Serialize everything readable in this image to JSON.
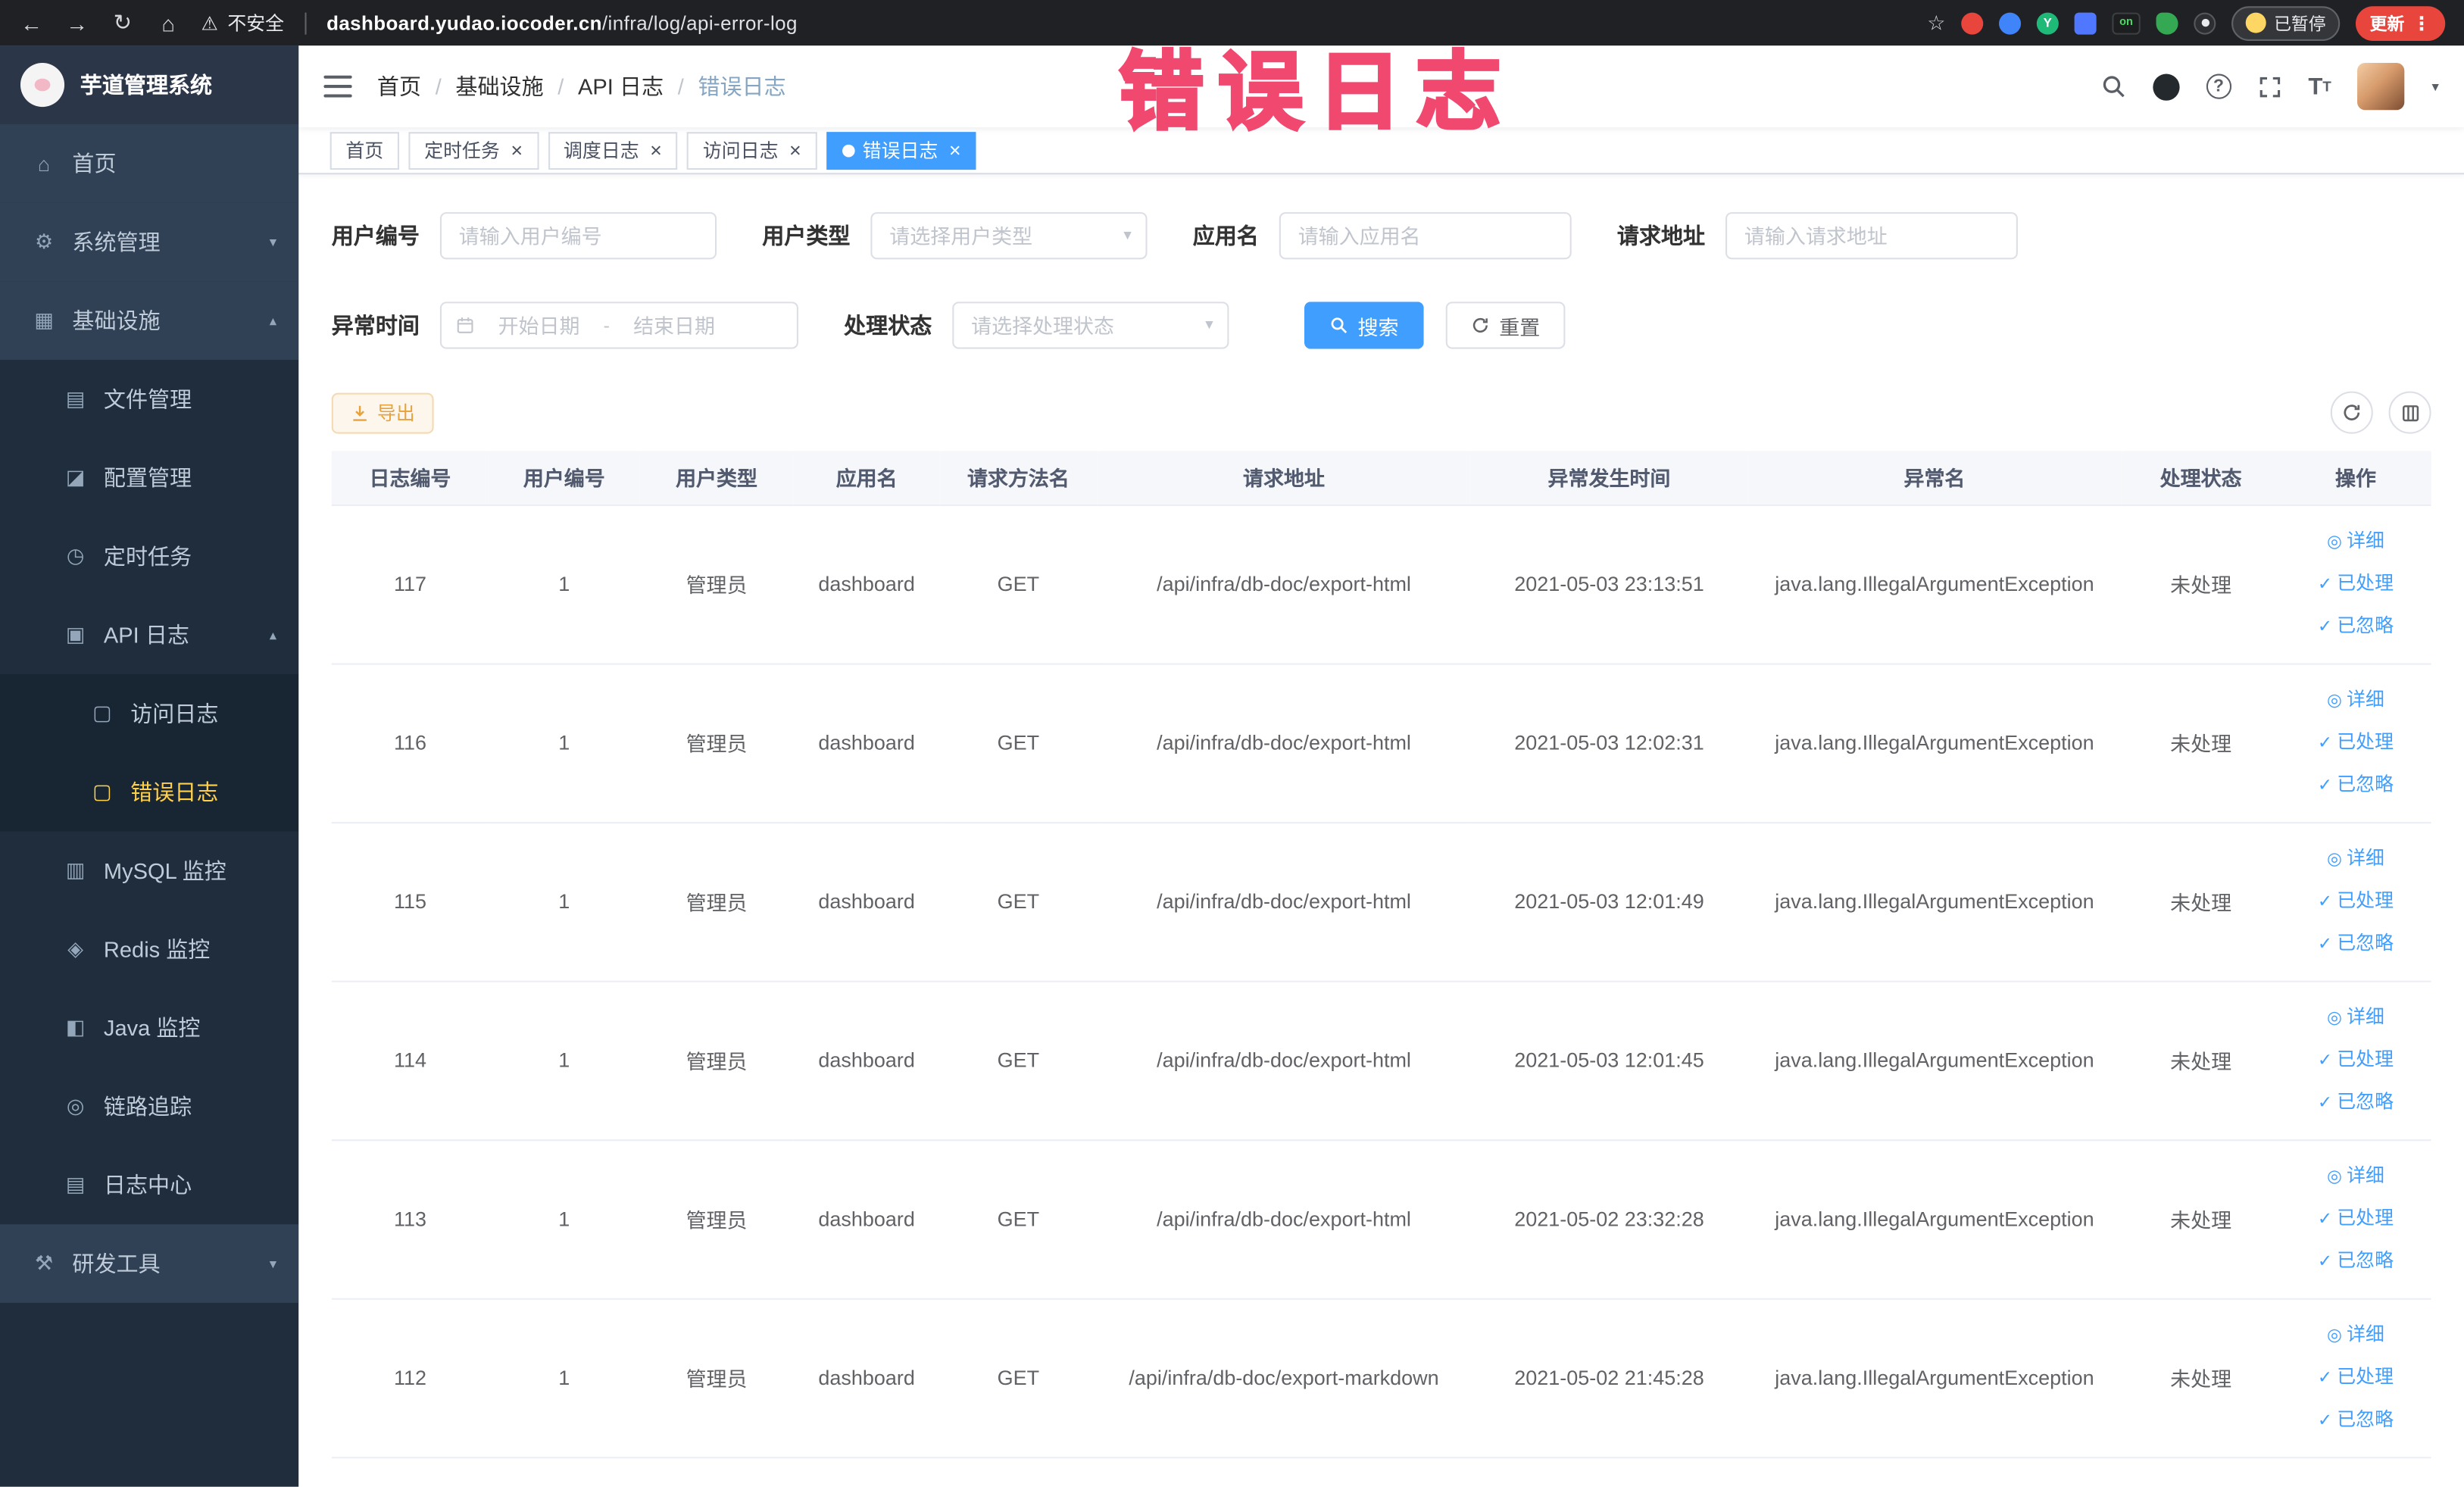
{
  "annotation": {
    "text": "错误日志"
  },
  "browser": {
    "security_label": "不安全",
    "url_domain": "dashboard.yudao.iocoder.cn",
    "url_path": "/infra/log/api-error-log",
    "extension_y_label": "Y",
    "extension_on_label": "on",
    "paused_badge": "已暂停",
    "update_button": "更新"
  },
  "icons": {
    "back": "←",
    "forward": "→",
    "reload": "↻",
    "home": "⌂",
    "warning": "⚠",
    "star": "☆",
    "kebab": "⋮",
    "close": "×",
    "select_chevron": "▾",
    "caret_down": "▾",
    "help": "?",
    "font_size": "T"
  },
  "sidebar": {
    "logo_title": "芋道管理系统",
    "items": [
      {
        "label": "首页",
        "glyph": "⌂"
      },
      {
        "label": "系统管理",
        "glyph": "⚙",
        "chevron": "▾"
      },
      {
        "label": "基础设施",
        "glyph": "▦",
        "chevron": "▴"
      },
      {
        "label": "文件管理",
        "glyph": "▤"
      },
      {
        "label": "配置管理",
        "glyph": "◪"
      },
      {
        "label": "定时任务",
        "glyph": "◷"
      },
      {
        "label": "API 日志",
        "glyph": "▣",
        "chevron": "▴"
      },
      {
        "label": "访问日志",
        "glyph": "▢"
      },
      {
        "label": "错误日志",
        "glyph": "▢"
      },
      {
        "label": "MySQL 监控",
        "glyph": "▥"
      },
      {
        "label": "Redis 监控",
        "glyph": "◈"
      },
      {
        "label": "Java 监控",
        "glyph": "◧"
      },
      {
        "label": "链路追踪",
        "glyph": "◎"
      },
      {
        "label": "日志中心",
        "glyph": "▤"
      },
      {
        "label": "研发工具",
        "glyph": "⚒",
        "chevron": "▾"
      }
    ]
  },
  "navbar": {
    "breadcrumb": [
      "首页",
      "基础设施",
      "API 日志",
      "错误日志"
    ]
  },
  "tabs": [
    {
      "label": "首页",
      "active": false,
      "closable": false
    },
    {
      "label": "定时任务",
      "active": false,
      "closable": true
    },
    {
      "label": "调度日志",
      "active": false,
      "closable": true
    },
    {
      "label": "访问日志",
      "active": false,
      "closable": true
    },
    {
      "label": "错误日志",
      "active": true,
      "closable": true
    }
  ],
  "filters": {
    "user_id": {
      "label": "用户编号",
      "placeholder": "请输入用户编号"
    },
    "user_type": {
      "label": "用户类型",
      "placeholder": "请选择用户类型"
    },
    "app_name": {
      "label": "应用名",
      "placeholder": "请输入应用名"
    },
    "request_url": {
      "label": "请求地址",
      "placeholder": "请输入请求地址"
    },
    "exception_time": {
      "label": "异常时间",
      "start_placeholder": "开始日期",
      "separator": "-",
      "end_placeholder": "结束日期"
    },
    "process_status": {
      "label": "处理状态",
      "placeholder": "请选择处理状态"
    },
    "search_button": "搜索",
    "reset_button": "重置"
  },
  "toolbar": {
    "export_button": "导出"
  },
  "table": {
    "columns": [
      "日志编号",
      "用户编号",
      "用户类型",
      "应用名",
      "请求方法名",
      "请求地址",
      "异常发生时间",
      "异常名",
      "处理状态",
      "操作"
    ],
    "actions": [
      {
        "label": "详细",
        "glyph": "◎"
      },
      {
        "label": "已处理",
        "glyph": "✓"
      },
      {
        "label": "已忽略",
        "glyph": "✓"
      }
    ],
    "rows": [
      {
        "log_id": "117",
        "user_id": "1",
        "user_type": "管理员",
        "app_name": "dashboard",
        "method": "GET",
        "url": "/api/infra/db-doc/export-html",
        "time": "2021-05-03 23:13:51",
        "exception": "java.lang.IllegalArgumentException",
        "status": "未处理"
      },
      {
        "log_id": "116",
        "user_id": "1",
        "user_type": "管理员",
        "app_name": "dashboard",
        "method": "GET",
        "url": "/api/infra/db-doc/export-html",
        "time": "2021-05-03 12:02:31",
        "exception": "java.lang.IllegalArgumentException",
        "status": "未处理"
      },
      {
        "log_id": "115",
        "user_id": "1",
        "user_type": "管理员",
        "app_name": "dashboard",
        "method": "GET",
        "url": "/api/infra/db-doc/export-html",
        "time": "2021-05-03 12:01:49",
        "exception": "java.lang.IllegalArgumentException",
        "status": "未处理"
      },
      {
        "log_id": "114",
        "user_id": "1",
        "user_type": "管理员",
        "app_name": "dashboard",
        "method": "GET",
        "url": "/api/infra/db-doc/export-html",
        "time": "2021-05-03 12:01:45",
        "exception": "java.lang.IllegalArgumentException",
        "status": "未处理"
      },
      {
        "log_id": "113",
        "user_id": "1",
        "user_type": "管理员",
        "app_name": "dashboard",
        "method": "GET",
        "url": "/api/infra/db-doc/export-html",
        "time": "2021-05-02 23:32:28",
        "exception": "java.lang.IllegalArgumentException",
        "status": "未处理"
      },
      {
        "log_id": "112",
        "user_id": "1",
        "user_type": "管理员",
        "app_name": "dashboard",
        "method": "GET",
        "url": "/api/infra/db-doc/export-markdown",
        "time": "2021-05-02 21:45:28",
        "exception": "java.lang.IllegalArgumentException",
        "status": "未处理"
      }
    ]
  },
  "colors": {
    "accent": "#409eff",
    "warning": "#e6a23c",
    "active_menu": "#ffd04b",
    "annotation": "#f1486f",
    "sidebar_bg": "#304156"
  }
}
